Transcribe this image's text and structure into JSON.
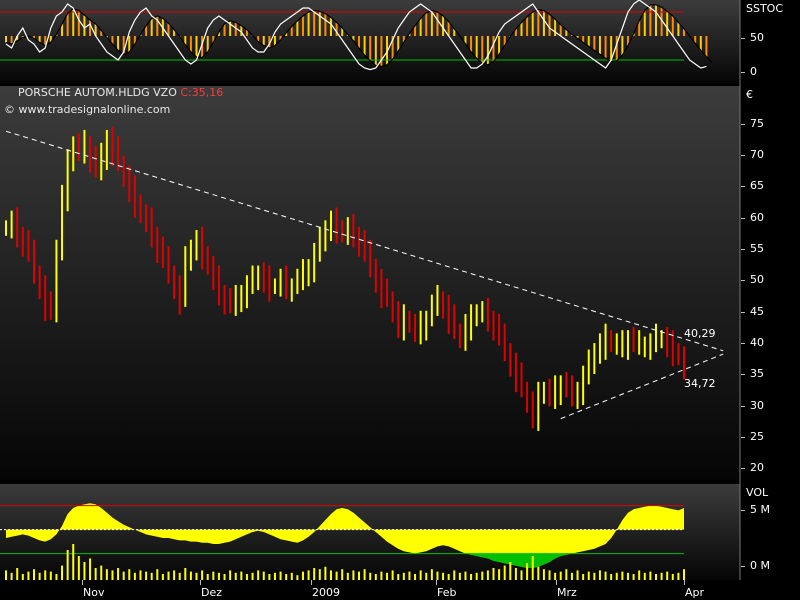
{
  "header": {
    "symbol": "PORSCHE AUTOM.HLDG VZO",
    "close_label": "C:35,16",
    "website": "© www.tradesignalonline.com"
  },
  "colors": {
    "up": "#ffff00",
    "down": "#e00000",
    "background": "#000000",
    "trendline": "#ffffff",
    "stoch_line": "#ffffff",
    "stoch_line2": "#000000",
    "vol_area": "#ffff00",
    "vol_fill_low": "#00c000",
    "vol_bar": "#ffff00",
    "upper_band": "#e00000",
    "lower_band": "#00c000"
  },
  "price_axis": {
    "title": "€",
    "ticks": [
      "75",
      "70",
      "65",
      "60",
      "55",
      "50",
      "45",
      "40",
      "35",
      "30",
      "25",
      "20"
    ]
  },
  "stoch_axis": {
    "title": "SSTOC",
    "ticks": [
      "50",
      "0"
    ]
  },
  "vol_axis": {
    "title": "VOL",
    "ticks": [
      "5 M",
      "0 M"
    ]
  },
  "x_axis": {
    "labels": [
      "Nov",
      "Dez",
      "2009",
      "Feb",
      "Mrz",
      "Apr"
    ]
  },
  "annotations": {
    "resistance": "40,29",
    "support": "34,72"
  },
  "chart_data": [
    {
      "type": "bar",
      "title": "PORSCHE AUTOM.HLDG VZO",
      "ylabel": "€",
      "ylim": [
        18,
        79
      ],
      "x_labels": [
        "Nov",
        "Dez",
        "2009",
        "Feb",
        "Mrz",
        "Apr"
      ],
      "grid": false,
      "series": [
        {
          "name": "close",
          "values": [
            57,
            58,
            56,
            55,
            53,
            50,
            48,
            45,
            44,
            54,
            62,
            67,
            70,
            69,
            70,
            68,
            66,
            68,
            71,
            69,
            67,
            65,
            63,
            61,
            59,
            58,
            56,
            54,
            52,
            50,
            48,
            46,
            52,
            54,
            55,
            53,
            51,
            49,
            47,
            46,
            45,
            46,
            47,
            48,
            49,
            50,
            49,
            48,
            48,
            49,
            48,
            48,
            49,
            50,
            51,
            53,
            55,
            57,
            58,
            57,
            56,
            57,
            56,
            55,
            53,
            51,
            49,
            47,
            46,
            44,
            42,
            43,
            42,
            41,
            42,
            43,
            45,
            46,
            45,
            43,
            41,
            40,
            42,
            43,
            44,
            44,
            43,
            42,
            40,
            38,
            36,
            34,
            32,
            30,
            28,
            31,
            32,
            31,
            32,
            33,
            32,
            31,
            32,
            34,
            36,
            38,
            39,
            40,
            39,
            39,
            39,
            40,
            39,
            39,
            39,
            39,
            40,
            40,
            39,
            38,
            37,
            35.16
          ]
        }
      ],
      "trendlines": [
        {
          "name": "resistance",
          "from": [
            0,
            72
          ],
          "to": [
            128,
            38
          ]
        },
        {
          "name": "support",
          "from": [
            99,
            27.5
          ],
          "to": [
            128,
            37.5
          ]
        }
      ],
      "annotations": [
        "40,29",
        "34,72"
      ]
    },
    {
      "type": "line",
      "title": "SSTOC",
      "ylim": [
        -10,
        95
      ],
      "series": [
        {
          "name": "%K",
          "values": [
            40,
            35,
            50,
            60,
            45,
            40,
            30,
            35,
            60,
            75,
            80,
            90,
            85,
            70,
            60,
            65,
            50,
            40,
            30,
            25,
            20,
            30,
            55,
            70,
            80,
            85,
            75,
            70,
            60,
            50,
            40,
            30,
            20,
            15,
            20,
            40,
            60,
            70,
            75,
            70,
            65,
            60,
            55,
            45,
            35,
            30,
            30,
            40,
            55,
            65,
            70,
            75,
            80,
            85,
            85,
            80,
            75,
            70,
            65,
            55,
            45,
            35,
            25,
            15,
            10,
            8,
            10,
            20,
            30,
            45,
            60,
            70,
            80,
            85,
            90,
            85,
            80,
            70,
            60,
            50,
            40,
            30,
            20,
            10,
            10,
            15,
            25,
            40,
            55,
            65,
            70,
            75,
            80,
            85,
            90,
            80,
            70,
            60,
            55,
            50,
            45,
            40,
            35,
            30,
            25,
            20,
            15,
            10,
            20,
            40,
            60,
            80,
            90,
            95,
            90,
            85,
            80,
            70,
            60,
            50,
            40,
            30,
            20,
            15,
            10,
            12
          ]
        },
        {
          "name": "%D",
          "values": [
            42,
            40,
            44,
            48,
            50,
            47,
            42,
            38,
            42,
            52,
            65,
            78,
            84,
            82,
            76,
            70,
            65,
            57,
            48,
            40,
            32,
            27,
            30,
            40,
            52,
            63,
            72,
            75,
            72,
            66,
            58,
            49,
            39,
            30,
            24,
            23,
            30,
            42,
            55,
            65,
            69,
            67,
            63,
            58,
            51,
            43,
            38,
            35,
            38,
            45,
            54,
            62,
            69,
            75,
            80,
            82,
            81,
            78,
            73,
            67,
            60,
            52,
            44,
            35,
            26,
            19,
            13,
            12,
            14,
            21,
            31,
            42,
            53,
            63,
            72,
            79,
            82,
            80,
            75,
            68,
            59,
            50,
            40,
            30,
            22,
            16,
            14,
            18,
            27,
            38,
            49,
            59,
            67,
            74,
            80,
            83,
            82,
            77,
            71,
            64,
            58,
            52,
            47,
            42,
            37,
            32,
            27,
            22,
            18,
            19,
            26,
            38,
            53,
            69,
            82,
            89,
            89,
            86,
            81,
            75,
            67,
            59,
            50,
            41,
            32,
            24,
            17
          ]
        }
      ]
    },
    {
      "type": "bar",
      "title": "VOL",
      "ylabel": "",
      "ylim": [
        0,
        8
      ],
      "series": [
        {
          "name": "volume",
          "values": [
            0.8,
            0.6,
            1.0,
            0.5,
            0.7,
            0.9,
            0.6,
            0.8,
            0.7,
            0.5,
            1.2,
            2.5,
            3.0,
            2.0,
            1.5,
            1.8,
            1.0,
            1.2,
            0.9,
            0.8,
            1.0,
            0.7,
            0.9,
            0.6,
            0.8,
            0.7,
            0.6,
            0.9,
            0.5,
            0.7,
            0.8,
            0.6,
            1.0,
            0.7,
            0.6,
            0.8,
            0.5,
            0.7,
            0.6,
            0.5,
            0.8,
            0.6,
            0.7,
            0.5,
            0.6,
            0.8,
            0.7,
            0.5,
            0.6,
            0.7,
            0.5,
            0.6,
            0.4,
            0.7,
            0.8,
            1.0,
            0.9,
            1.1,
            0.8,
            0.7,
            0.9,
            0.6,
            0.8,
            0.7,
            0.9,
            0.6,
            0.5,
            0.7,
            0.6,
            0.8,
            0.5,
            0.6,
            0.7,
            0.5,
            0.8,
            0.6,
            0.9,
            0.7,
            0.6,
            0.5,
            0.8,
            0.6,
            0.7,
            0.5,
            0.6,
            0.7,
            0.8,
            1.0,
            0.9,
            1.2,
            1.5,
            1.0,
            0.8,
            1.4,
            2.0,
            1.1,
            0.9,
            0.8,
            0.6,
            0.7,
            0.9,
            0.6,
            0.8,
            0.5,
            0.7,
            0.6,
            0.8,
            0.7,
            0.5,
            0.6,
            0.7,
            0.6,
            0.5,
            0.8,
            0.6,
            0.7,
            0.5,
            0.6,
            0.7,
            0.5,
            0.6,
            0.9,
            1.3
          ]
        },
        {
          "name": "volume-ma",
          "values": [
            3.5,
            3.6,
            3.7,
            3.8,
            3.7,
            3.5,
            3.3,
            3.2,
            3.4,
            3.8,
            4.5,
            5.5,
            6.0,
            6.2,
            6.3,
            6.4,
            6.3,
            6.0,
            5.6,
            5.2,
            4.9,
            4.6,
            4.4,
            4.2,
            4.0,
            3.8,
            3.7,
            3.6,
            3.5,
            3.5,
            3.4,
            3.3,
            3.3,
            3.2,
            3.2,
            3.1,
            3.1,
            3.0,
            3.0,
            3.1,
            3.2,
            3.4,
            3.6,
            3.8,
            4.0,
            4.1,
            4.0,
            3.8,
            3.6,
            3.4,
            3.3,
            3.2,
            3.1,
            3.3,
            3.6,
            4.0,
            4.5,
            5.0,
            5.5,
            5.9,
            6.0,
            5.9,
            5.6,
            5.2,
            4.8,
            4.4,
            4.0,
            3.6,
            3.2,
            2.9,
            2.6,
            2.4,
            2.3,
            2.2,
            2.3,
            2.4,
            2.6,
            2.8,
            2.9,
            2.8,
            2.6,
            2.4,
            2.2,
            2.1,
            2.0,
            1.9,
            1.8,
            1.6,
            1.5,
            1.4,
            1.3,
            1.2,
            1.1,
            1.0,
            1.0,
            1.1,
            1.3,
            1.5,
            1.8,
            2.0,
            2.1,
            2.2,
            2.3,
            2.4,
            2.5,
            2.6,
            2.8,
            3.0,
            3.5,
            4.2,
            5.0,
            5.6,
            5.9,
            6.0,
            6.1,
            6.2,
            6.2,
            6.1,
            6.0,
            5.9,
            5.8,
            6.0,
            5.5,
            5.0,
            4.6
          ]
        }
      ],
      "bands": {
        "upper": 6.2,
        "middle": 4.2,
        "lower": 2.2
      }
    }
  ]
}
